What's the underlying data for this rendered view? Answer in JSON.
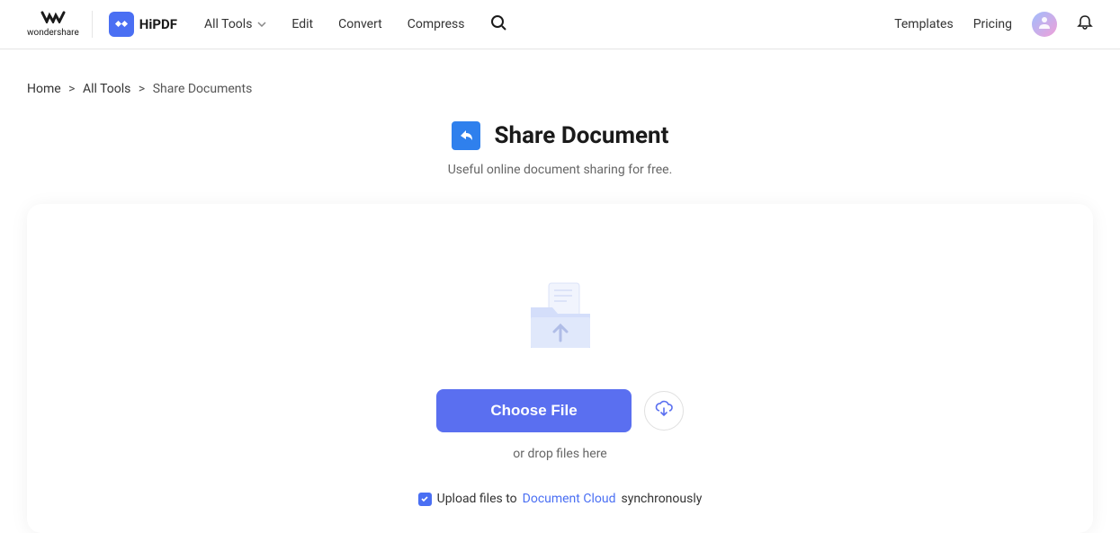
{
  "header": {
    "wondershare_label": "wondershare",
    "hipdf_label": "HiPDF",
    "nav": {
      "all_tools": "All Tools",
      "edit": "Edit",
      "convert": "Convert",
      "compress": "Compress"
    },
    "templates": "Templates",
    "pricing": "Pricing"
  },
  "breadcrumb": {
    "home": "Home",
    "all_tools": "All Tools",
    "current": "Share Documents"
  },
  "page": {
    "title": "Share Document",
    "subtitle": "Useful online document sharing for free."
  },
  "upload": {
    "choose_label": "Choose File",
    "drop_hint": "or drop files here",
    "sync_prefix": "Upload files to",
    "sync_link": "Document Cloud",
    "sync_suffix": "synchronously"
  }
}
